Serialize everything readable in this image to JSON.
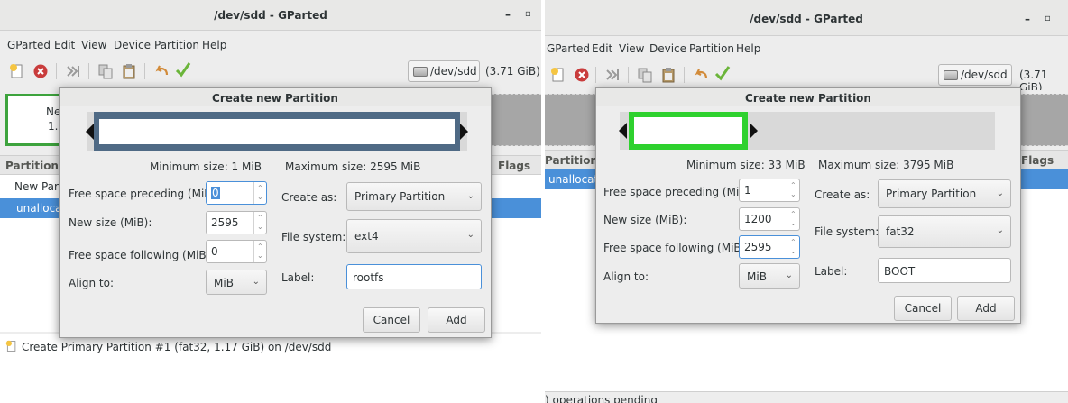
{
  "left": {
    "window_title": "/dev/sdd - GParted",
    "menu": [
      "GParted",
      "Edit",
      "View",
      "Device",
      "Partition",
      "Help"
    ],
    "device": "/dev/sdd",
    "device_size": "(3.71 GiB)",
    "graph_label_1": "Ne",
    "graph_label_2": "1.",
    "col_partition": "Partition",
    "col_flags": "Flags",
    "row_new": "New Part",
    "row_unalloc": "unallocate",
    "pending_op": "Create Primary Partition #1 (fat32, 1.17 GiB) on /dev/sdd",
    "dialog": {
      "title": "Create new Partition",
      "min_size": "Minimum size: 1 MiB",
      "max_size": "Maximum size: 2595 MiB",
      "preceding_label": "Free space preceding (MiB):",
      "preceding_value": "0",
      "newsize_label": "New size (MiB):",
      "newsize_value": "2595",
      "following_label": "Free space following (MiB):",
      "following_value": "0",
      "align_label": "Align to:",
      "align_value": "MiB",
      "createas_label": "Create as:",
      "createas_value": "Primary Partition",
      "fs_label": "File system:",
      "fs_value": "ext4",
      "label_label": "Label:",
      "label_value": "rootfs",
      "cancel": "Cancel",
      "add": "Add"
    }
  },
  "right": {
    "window_title": "/dev/sdd - GParted",
    "menu": [
      "GParted",
      "Edit",
      "View",
      "Device",
      "Partition",
      "Help"
    ],
    "device": "/dev/sdd",
    "device_size": "(3.71 GiB)",
    "col_partition": "Partition",
    "col_flags": "Flags",
    "row_unalloc": "unallocate",
    "status": ") operations pending",
    "dialog": {
      "title": "Create new Partition",
      "min_size": "Minimum size: 33 MiB",
      "max_size": "Maximum size: 3795 MiB",
      "preceding_label": "Free space preceding (MiB):",
      "preceding_value": "1",
      "newsize_label": "New size (MiB):",
      "newsize_value": "1200",
      "following_label": "Free space following (MiB):",
      "following_value": "2595",
      "align_label": "Align to:",
      "align_value": "MiB",
      "createas_label": "Create as:",
      "createas_value": "Primary Partition",
      "fs_label": "File system:",
      "fs_value": "fat32",
      "label_label": "Label:",
      "label_value": "BOOT",
      "cancel": "Cancel",
      "add": "Add"
    }
  },
  "colors": {
    "partition_fat32": "#2ed12e",
    "partition_ext4": "#4f6a85",
    "selection": "#4a90d9"
  }
}
